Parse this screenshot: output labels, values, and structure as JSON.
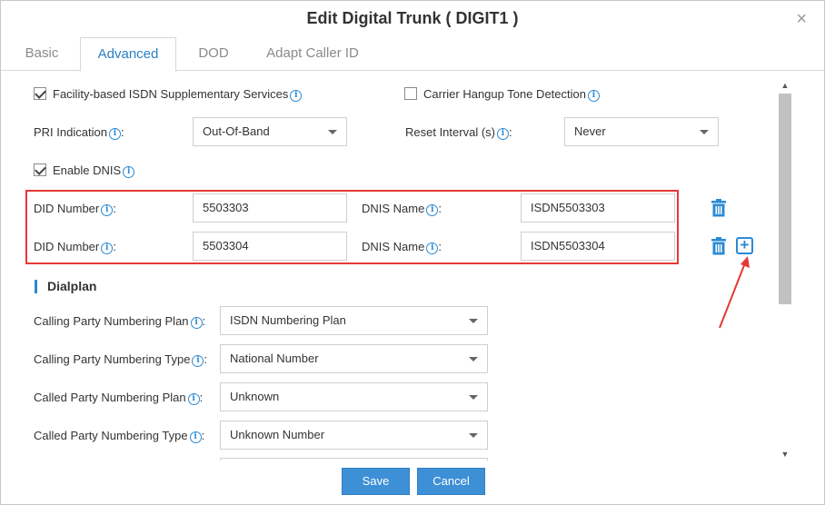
{
  "dialog": {
    "title": "Edit Digital Trunk ( DIGIT1 )",
    "close": "×"
  },
  "tabs": [
    {
      "label": "Basic"
    },
    {
      "label": "Advanced"
    },
    {
      "label": "DOD"
    },
    {
      "label": "Adapt Caller ID"
    }
  ],
  "options": {
    "facility_isdn": {
      "label": "Facility-based ISDN Supplementary Services",
      "checked": true
    },
    "carrier_hangup": {
      "label": "Carrier Hangup Tone Detection",
      "checked": false
    },
    "enable_dnis": {
      "label": "Enable DNIS",
      "checked": true
    }
  },
  "pri_indication": {
    "label": "PRI Indication",
    "colon": ":",
    "value": "Out-Of-Band"
  },
  "reset_interval": {
    "label": "Reset Interval (s)",
    "colon": ":",
    "value": "Never"
  },
  "dnis_rows": [
    {
      "did_label": "DID Number",
      "did_value": "5503303",
      "dnis_label": "DNIS Name",
      "dnis_value": "ISDN5503303"
    },
    {
      "did_label": "DID Number",
      "did_value": "5503304",
      "dnis_label": "DNIS Name",
      "dnis_value": "ISDN5503304"
    }
  ],
  "colon": ":",
  "dialplan": {
    "title": "Dialplan",
    "fields": [
      {
        "label": "Calling Party Numbering Plan",
        "value": "ISDN Numbering Plan"
      },
      {
        "label": "Calling Party Numbering Type",
        "value": "National Number"
      },
      {
        "label": "Called Party Numbering Plan",
        "value": "Unknown"
      },
      {
        "label": "Called Party Numbering Type",
        "value": "Unknown Number"
      }
    ]
  },
  "buttons": {
    "save": "Save",
    "cancel": "Cancel"
  },
  "icons": {
    "info": "info-icon",
    "trash": "trash-icon",
    "plus": "plus-icon",
    "close": "close-icon"
  },
  "colors": {
    "accent": "#2a8ad4",
    "highlight": "#e53935",
    "button": "#3d8fd6"
  }
}
